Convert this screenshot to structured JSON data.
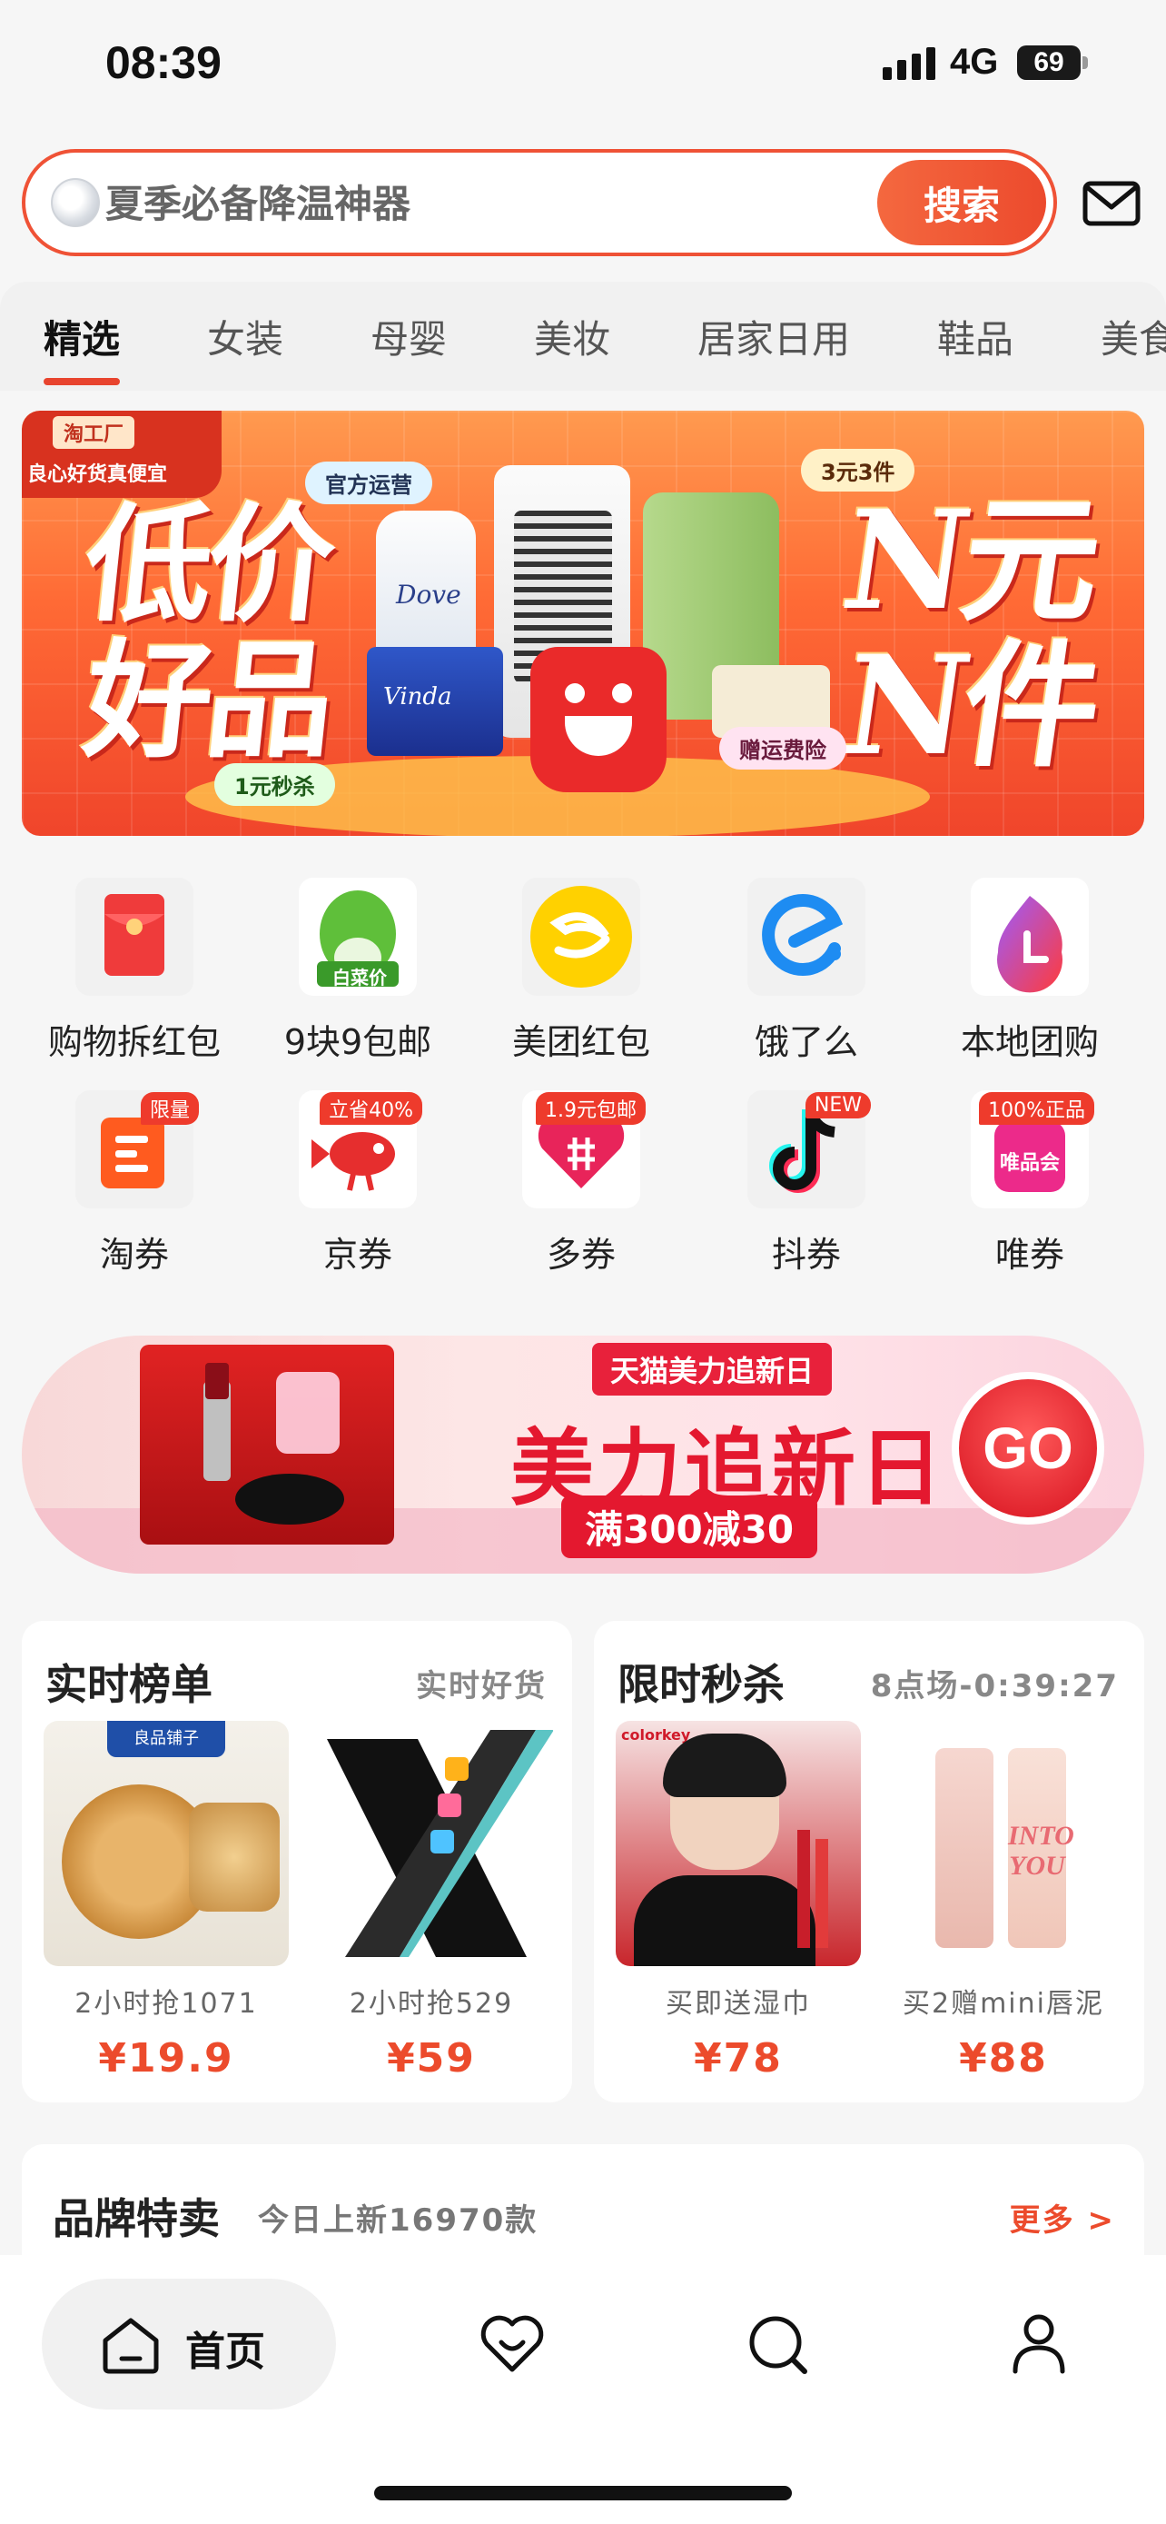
{
  "status_bar": {
    "time": "08:39",
    "network": "4G",
    "battery": "69"
  },
  "search": {
    "placeholder": "夏季必备降温神器",
    "button_label": "搜索"
  },
  "tabs": [
    "精选",
    "女装",
    "母婴",
    "美妆",
    "居家日用",
    "鞋品",
    "美食"
  ],
  "hero_banner": {
    "tag_top": "淘工厂",
    "tag_sub": "良心好货真便宜",
    "left_line1": "低价",
    "left_line2": "好品",
    "right_line1": "N元",
    "right_line2": "N件",
    "pill_official": "官方运营",
    "pill_deal": "3元3件",
    "pill_flash": "1元秒杀",
    "pill_insurance": "赠运费险",
    "bottle_brand": "Dove",
    "tissue_brand": "Vinda"
  },
  "quick_icons": [
    {
      "label": "购物拆红包",
      "icon": "red-envelope-icon",
      "badge": ""
    },
    {
      "label": "9块9包邮",
      "icon": "cabbage-price-icon",
      "badge": "",
      "icon_text": "白菜价"
    },
    {
      "label": "美团红包",
      "icon": "meituan-icon",
      "badge": ""
    },
    {
      "label": "饿了么",
      "icon": "eleme-icon",
      "badge": ""
    },
    {
      "label": "本地团购",
      "icon": "local-group-buy-icon",
      "badge": ""
    },
    {
      "label": "淘券",
      "icon": "taobao-coupon-icon",
      "badge": "限量"
    },
    {
      "label": "京券",
      "icon": "jd-coupon-icon",
      "badge": "立省40%"
    },
    {
      "label": "多券",
      "icon": "pdd-coupon-icon",
      "badge": "1.9元包邮"
    },
    {
      "label": "抖券",
      "icon": "douyin-coupon-icon",
      "badge": "NEW"
    },
    {
      "label": "唯券",
      "icon": "vip-coupon-icon",
      "badge": "100%正品",
      "icon_text": "唯品会"
    }
  ],
  "promo_banner": {
    "tag": "天猫美力追新日",
    "title": "美力追新日",
    "deal": "满300减30",
    "go": "GO"
  },
  "ranking_card": {
    "title": "实时榜单",
    "subtitle": "实时好货",
    "items": [
      {
        "caption": "2小时抢1071",
        "price": "¥19.9",
        "brand": "良品铺子"
      },
      {
        "caption": "2小时抢529",
        "price": "¥59"
      }
    ]
  },
  "flash_card": {
    "title": "限时秒杀",
    "subtitle": "8点场-0:39:27",
    "items": [
      {
        "caption": "买即送湿巾",
        "price": "¥78",
        "brand": "colorkey"
      },
      {
        "caption": "买2赠mini唇泥",
        "price": "¥88",
        "brand": "INTO YOU"
      }
    ]
  },
  "brand_section": {
    "title": "品牌特卖",
    "subtitle": "今日上新16970款",
    "more": "更多 >"
  },
  "bottom_nav": {
    "home": "首页"
  },
  "colors": {
    "accent": "#ec4b2c",
    "accent_dark": "#e4182f",
    "background": "#f6f6f6"
  }
}
